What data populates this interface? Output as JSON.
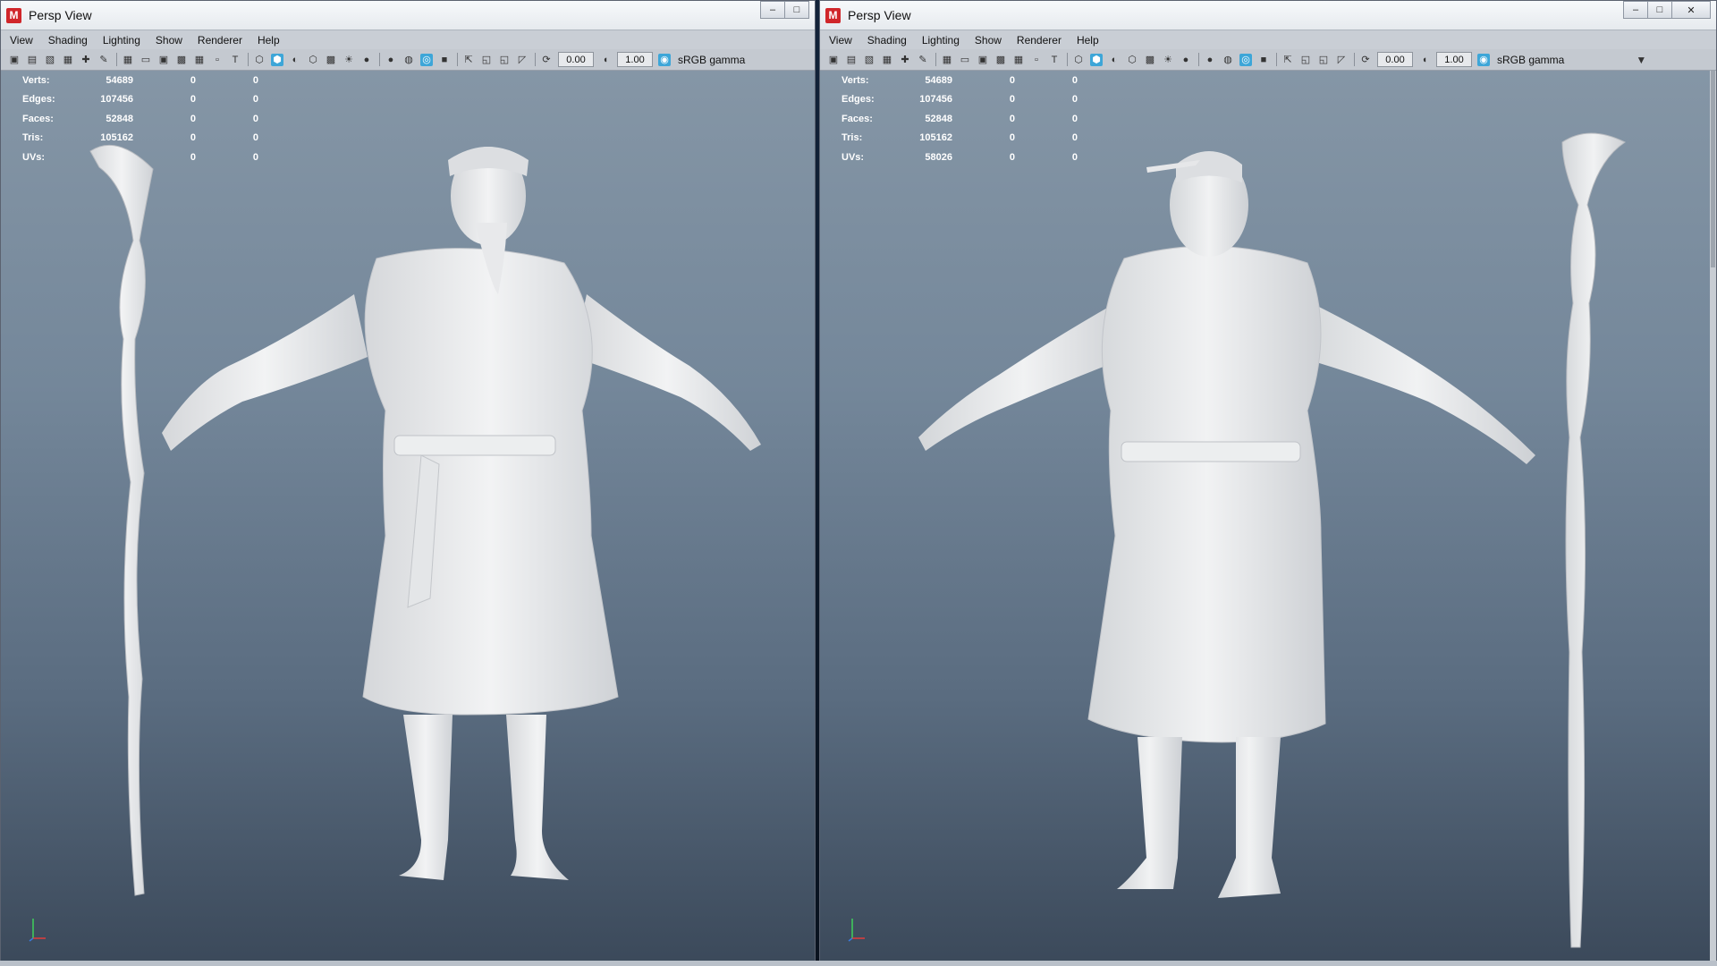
{
  "left_window": {
    "title": "Persp View",
    "logo": "M",
    "menu": [
      "View",
      "Shading",
      "Lighting",
      "Show",
      "Renderer",
      "Help"
    ],
    "toolbar": {
      "value_a": "0.00",
      "value_b": "1.00",
      "colorspace": "sRGB gamma"
    },
    "hud": [
      {
        "label": "Verts:",
        "value": "54689",
        "c2": "0",
        "c3": "0"
      },
      {
        "label": "Edges:",
        "value": "107456",
        "c2": "0",
        "c3": "0"
      },
      {
        "label": "Faces:",
        "value": "52848",
        "c2": "0",
        "c3": "0"
      },
      {
        "label": "Tris:",
        "value": "105162",
        "c2": "0",
        "c3": "0"
      },
      {
        "label": "UVs:",
        "value": "",
        "c2": "0",
        "c3": "0"
      }
    ]
  },
  "right_window": {
    "title": "Persp View",
    "logo": "M",
    "menu": [
      "View",
      "Shading",
      "Lighting",
      "Show",
      "Renderer",
      "Help"
    ],
    "toolbar": {
      "value_a": "0.00",
      "value_b": "1.00",
      "colorspace": "sRGB gamma"
    },
    "hud": [
      {
        "label": "Verts:",
        "value": "54689",
        "c2": "0",
        "c3": "0"
      },
      {
        "label": "Edges:",
        "value": "107456",
        "c2": "0",
        "c3": "0"
      },
      {
        "label": "Faces:",
        "value": "52848",
        "c2": "0",
        "c3": "0"
      },
      {
        "label": "Tris:",
        "value": "105162",
        "c2": "0",
        "c3": "0"
      },
      {
        "label": "UVs:",
        "value": "58026",
        "c2": "0",
        "c3": "0"
      }
    ]
  },
  "colors": {
    "viewport_top": "#8596a6",
    "viewport_bottom": "#3b495a",
    "accent": "#3da6d8",
    "logo_red": "#d0262a",
    "model": "#e9eaec"
  }
}
